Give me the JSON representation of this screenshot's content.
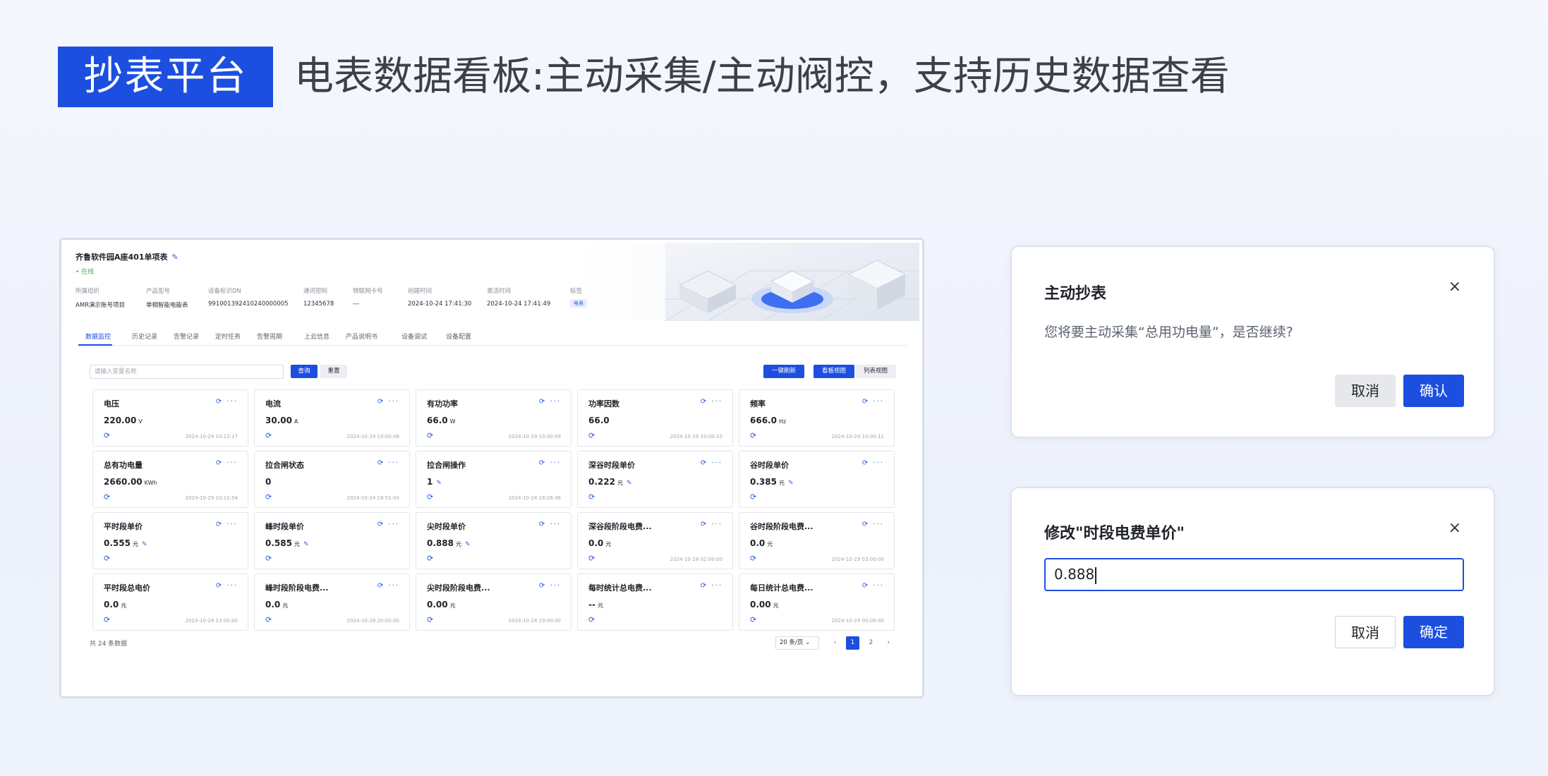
{
  "hero": {
    "badge": "抄表平台",
    "title": "电表数据看板:主动采集/主动阀控，支持历史数据查看"
  },
  "device": {
    "name": "齐鲁软件园A座401单项表",
    "edit_icon": "pencil-icon",
    "status": "• 在线",
    "meta": [
      {
        "key": "所属组织",
        "value": "AMR演示账号项目"
      },
      {
        "key": "产品型号",
        "value": "单相智能电能表"
      },
      {
        "key": "设备标识DN",
        "value": "991001392410240000005"
      },
      {
        "key": "通讯密码",
        "value": "12345678"
      },
      {
        "key": "物联网卡号",
        "value": "---"
      },
      {
        "key": "创建时间",
        "value": "2024-10-24 17:41:30"
      },
      {
        "key": "激活时间",
        "value": "2024-10-24 17:41:49"
      },
      {
        "key": "标签",
        "value": "电表"
      }
    ]
  },
  "tabs": [
    "数据监控",
    "历史记录",
    "告警记录",
    "定时任务",
    "告警周期",
    "上云信息",
    "产品说明书",
    "设备调试",
    "设备配置"
  ],
  "toolbar": {
    "search_placeholder": "请输入变量名称",
    "query": "查询",
    "reset": "重置",
    "refresh_all": "一键刷新",
    "board_view": "看板视图",
    "list_view": "列表视图"
  },
  "cards": [
    {
      "name": "电压",
      "value": "220.00",
      "unit": "V",
      "editable": false,
      "ts": "2024-10-29 10:12:17"
    },
    {
      "name": "电流",
      "value": "30.00",
      "unit": "A",
      "editable": false,
      "ts": "2024-10-29 10:00:08"
    },
    {
      "name": "有功功率",
      "value": "66.0",
      "unit": "W",
      "editable": false,
      "ts": "2024-10-29 10:00:09"
    },
    {
      "name": "功率因数",
      "value": "66.0",
      "unit": "",
      "editable": false,
      "ts": "2024-10-29 10:00:10"
    },
    {
      "name": "频率",
      "value": "666.0",
      "unit": "Hz",
      "editable": false,
      "ts": "2024-10-29 10:00:11"
    },
    {
      "name": "总有功电量",
      "value": "2660.00",
      "unit": "KWh",
      "editable": false,
      "ts": "2024-10-29 10:12:54"
    },
    {
      "name": "拉合闸状态",
      "value": "0",
      "unit": "",
      "editable": false,
      "ts": "2024-10-24 18:51:04"
    },
    {
      "name": "拉合闸操作",
      "value": "1",
      "unit": "",
      "editable": true,
      "ts": "2024-10-24 18:26:36"
    },
    {
      "name": "深谷时段单价",
      "value": "0.222",
      "unit": "元",
      "editable": true,
      "ts": ""
    },
    {
      "name": "谷时段单价",
      "value": "0.385",
      "unit": "元",
      "editable": true,
      "ts": ""
    },
    {
      "name": "平时段单价",
      "value": "0.555",
      "unit": "元",
      "editable": true,
      "ts": ""
    },
    {
      "name": "峰时段单价",
      "value": "0.585",
      "unit": "元",
      "editable": true,
      "ts": ""
    },
    {
      "name": "尖时段单价",
      "value": "0.888",
      "unit": "元",
      "editable": true,
      "ts": ""
    },
    {
      "name": "深谷段阶段电费...",
      "value": "0.0",
      "unit": "元",
      "editable": false,
      "ts": "2024-10-28 02:00:00"
    },
    {
      "name": "谷时段阶段电费...",
      "value": "0.0",
      "unit": "元",
      "editable": false,
      "ts": "2024-10-29 03:00:00"
    },
    {
      "name": "平时段总电价",
      "value": "0.0",
      "unit": "元",
      "editable": false,
      "ts": "2024-10-28 23:00:00"
    },
    {
      "name": "峰时段阶段电费...",
      "value": "0.0",
      "unit": "元",
      "editable": false,
      "ts": "2024-10-28 20:00:00"
    },
    {
      "name": "尖时段阶段电费...",
      "value": "0.00",
      "unit": "元",
      "editable": false,
      "ts": "2024-10-28 19:00:00"
    },
    {
      "name": "每时统计总电费...",
      "value": "--",
      "unit": "元",
      "editable": false,
      "ts": ""
    },
    {
      "name": "每日统计总电费...",
      "value": "0.00",
      "unit": "元",
      "editable": false,
      "ts": "2024-10-29 00:00:00"
    }
  ],
  "card_ops": "⟳ ···",
  "pagination": {
    "total": "共 24 条数据",
    "page_size": "20 条/页",
    "prev": "‹",
    "pages": [
      "1",
      "2"
    ],
    "current": "1",
    "next": "›"
  },
  "dialog_collect": {
    "title": "主动抄表",
    "close": "×",
    "message": "您将要主动采集“总用功电量”，是否继续?",
    "cancel": "取消",
    "confirm": "确认"
  },
  "dialog_edit": {
    "title": "修改\"时段电费单价\"",
    "close": "×",
    "input_value": "0.888",
    "cancel": "取消",
    "confirm": "确定"
  },
  "colors": {
    "primary": "#1c4fe0",
    "online": "#4caf50",
    "text": "#1f2329"
  }
}
